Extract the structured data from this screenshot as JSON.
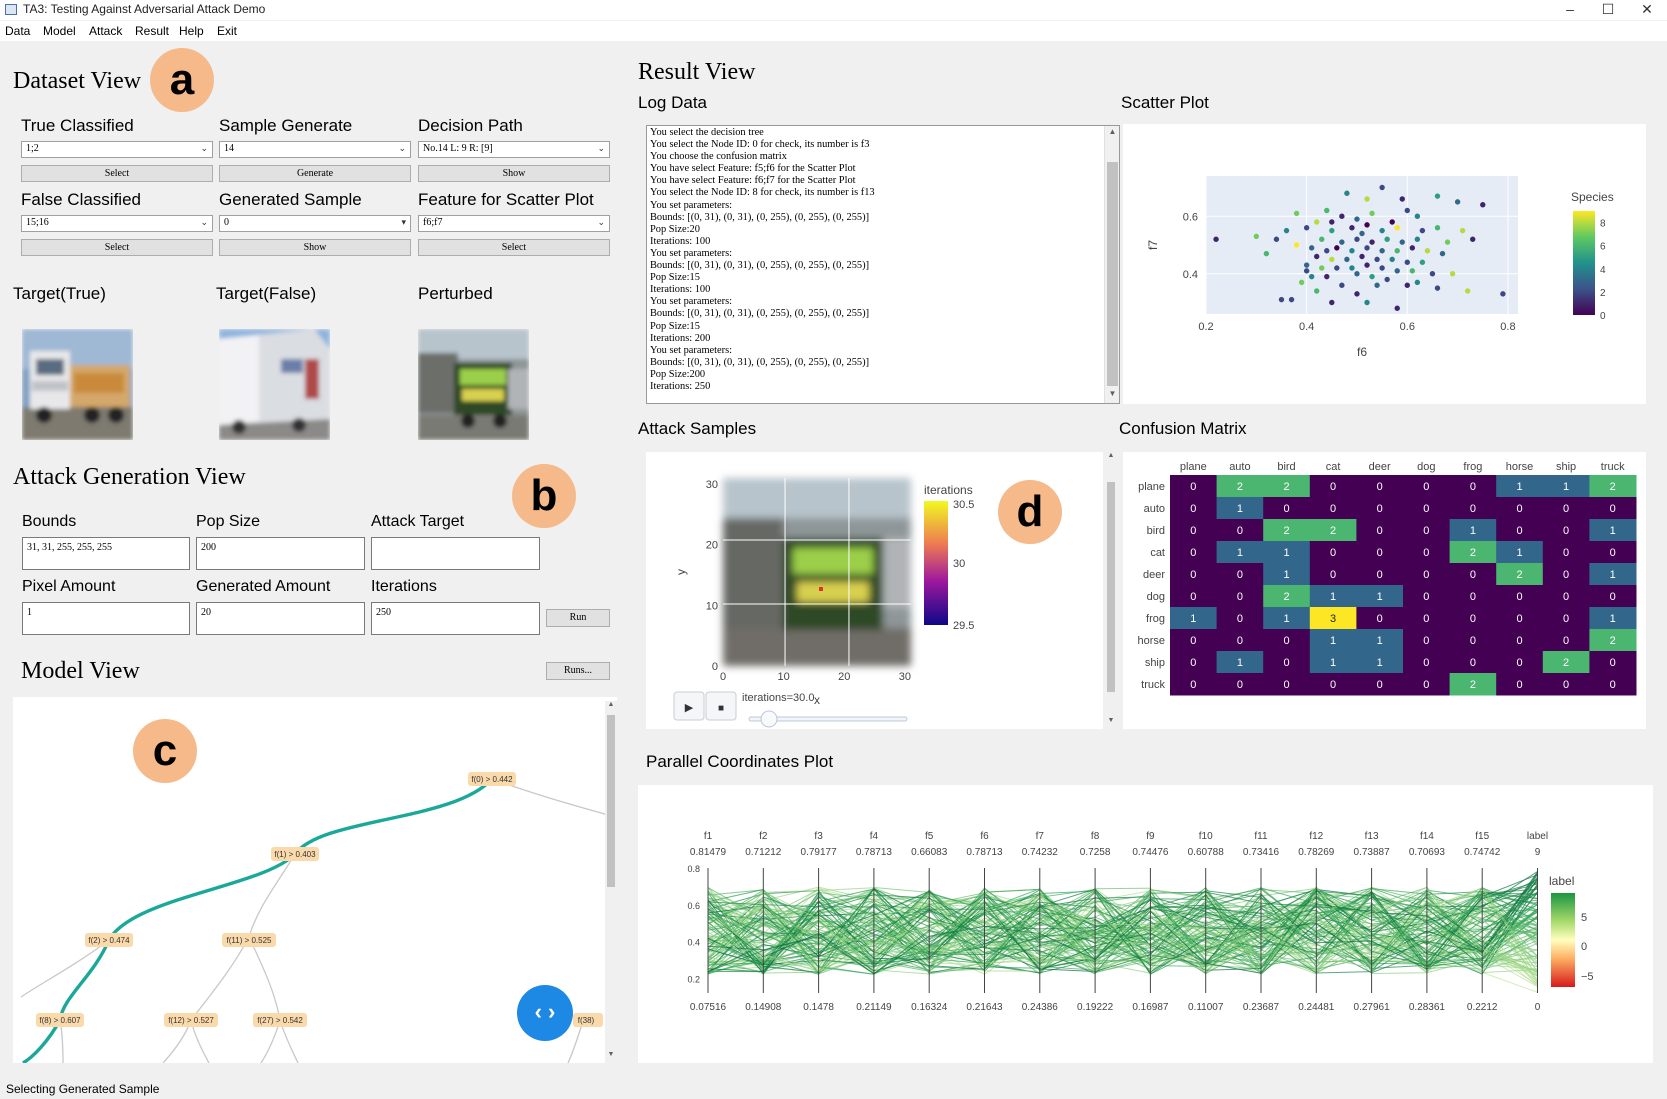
{
  "window": {
    "title": "TA3: Testing Against Adversarial Attack Demo",
    "minimize": "–",
    "maximize": "☐",
    "close": "✕"
  },
  "menu": [
    "Data",
    "Model",
    "Attack",
    "Result",
    "Help",
    "Exit"
  ],
  "badges": {
    "a": "a",
    "b": "b",
    "c": "c",
    "d": "d"
  },
  "dataset_view": {
    "title": "Dataset View",
    "true_classified": {
      "label": "True Classified",
      "value": "1;2",
      "button": "Select"
    },
    "sample_generate": {
      "label": "Sample Generate",
      "value": "14",
      "button": "Generate"
    },
    "decision_path": {
      "label": "Decision Path",
      "value": "No.14 L: 9 R: [9]",
      "button": "Show"
    },
    "false_classified": {
      "label": "False Classified",
      "value": "15;16",
      "button": "Select"
    },
    "generated_sample": {
      "label": "Generated Sample",
      "value": "0",
      "button": "Show"
    },
    "feature_scatter": {
      "label": "Feature for Scatter Plot",
      "value": "f6;f7",
      "button": "Select"
    },
    "images": {
      "target_true": "Target(True)",
      "target_false": "Target(False)",
      "perturbed": "Perturbed"
    }
  },
  "attack_view": {
    "title": "Attack Generation View",
    "bounds": {
      "label": "Bounds",
      "value": "31, 31, 255, 255, 255"
    },
    "pop_size": {
      "label": "Pop Size",
      "value": "200"
    },
    "attack_target": {
      "label": "Attack Target",
      "value": ""
    },
    "pixel_amount": {
      "label": "Pixel Amount",
      "value": "1"
    },
    "generated_amount": {
      "label": "Generated Amount",
      "value": "20"
    },
    "iterations": {
      "label": "Iterations",
      "value": "250"
    },
    "run_button": "Run"
  },
  "model_view": {
    "title": "Model View",
    "runs_button": "Runs...",
    "nodes": [
      "f(0) > 0.442",
      "f(1) > 0.403",
      "f(2) > 0.474",
      "f(11) > 0.525",
      "f(8) > 0.607",
      "f(12) > 0.527",
      "f(27) > 0.542",
      "f(38)"
    ],
    "toggle_icon": "‹ ›"
  },
  "result_view": {
    "title": "Result View",
    "log_title": "Log Data",
    "log_lines": [
      "You select the decision tree",
      "You select the Node ID: 0 for check, its number is f3",
      "You choose the confusion matrix",
      "You have select Feature: f5;f6 for the Scatter Plot",
      "You have select Feature: f6;f7 for the Scatter Plot",
      "You select the Node ID: 8 for check, its number is f13",
      "You set parameters:",
      "Bounds: [(0, 31), (0, 31), (0, 255), (0, 255), (0, 255)]",
      "Pop Size:20",
      "Iterations: 100",
      "You set parameters:",
      "Bounds: [(0, 31), (0, 31), (0, 255), (0, 255), (0, 255)]",
      "Pop Size:15",
      "Iterations: 100",
      "You set parameters:",
      "Bounds: [(0, 31), (0, 31), (0, 255), (0, 255), (0, 255)]",
      "Pop Size:15",
      "Iterations: 200",
      "You set parameters:",
      "Bounds: [(0, 31), (0, 31), (0, 255), (0, 255), (0, 255)]",
      "Pop Size:200",
      "Iterations: 250"
    ],
    "scatter_title": "Scatter Plot",
    "attack_title": "Attack Samples",
    "confusion_title": "Confusion Matrix",
    "parallel_title": "Parallel Coordinates Plot"
  },
  "status": "Selecting Generated Sample",
  "chart_data": [
    {
      "type": "scatter",
      "xlabel": "f6",
      "ylabel": "f7",
      "xticks": [
        "0.2",
        "0.4",
        "0.6",
        "0.8"
      ],
      "yticks": [
        "0.4",
        "0.6"
      ],
      "xlim": [
        0.2,
        0.82
      ],
      "ylim": [
        0.26,
        0.74
      ],
      "colorbar": {
        "title": "Species",
        "ticks": [
          "0",
          "2",
          "4",
          "6",
          "8"
        ],
        "range": [
          0,
          9
        ]
      },
      "points": [
        [
          0.55,
          0.7,
          2
        ],
        [
          0.48,
          0.68,
          4
        ],
        [
          0.52,
          0.66,
          8
        ],
        [
          0.59,
          0.66,
          1
        ],
        [
          0.7,
          0.65,
          3
        ],
        [
          0.66,
          0.67,
          5
        ],
        [
          0.75,
          0.64,
          1
        ],
        [
          0.44,
          0.62,
          6
        ],
        [
          0.38,
          0.61,
          7
        ],
        [
          0.6,
          0.62,
          2
        ],
        [
          0.62,
          0.6,
          4
        ],
        [
          0.47,
          0.6,
          1
        ],
        [
          0.5,
          0.59,
          3
        ],
        [
          0.53,
          0.61,
          7
        ],
        [
          0.57,
          0.58,
          0
        ],
        [
          0.42,
          0.58,
          8
        ],
        [
          0.4,
          0.56,
          2
        ],
        [
          0.45,
          0.55,
          5
        ],
        [
          0.49,
          0.56,
          1
        ],
        [
          0.51,
          0.54,
          3
        ],
        [
          0.55,
          0.55,
          4
        ],
        [
          0.58,
          0.56,
          9
        ],
        [
          0.63,
          0.55,
          2
        ],
        [
          0.66,
          0.56,
          6
        ],
        [
          0.71,
          0.55,
          8
        ],
        [
          0.36,
          0.55,
          4
        ],
        [
          0.3,
          0.53,
          7
        ],
        [
          0.22,
          0.52,
          1
        ],
        [
          0.34,
          0.52,
          2
        ],
        [
          0.43,
          0.52,
          6
        ],
        [
          0.47,
          0.51,
          3
        ],
        [
          0.5,
          0.52,
          2
        ],
        [
          0.53,
          0.51,
          1
        ],
        [
          0.56,
          0.52,
          5
        ],
        [
          0.59,
          0.51,
          3
        ],
        [
          0.62,
          0.52,
          4
        ],
        [
          0.68,
          0.51,
          7
        ],
        [
          0.73,
          0.52,
          1
        ],
        [
          0.38,
          0.5,
          9
        ],
        [
          0.41,
          0.49,
          3
        ],
        [
          0.44,
          0.48,
          2
        ],
        [
          0.46,
          0.49,
          0
        ],
        [
          0.49,
          0.48,
          4
        ],
        [
          0.52,
          0.49,
          2
        ],
        [
          0.55,
          0.48,
          3
        ],
        [
          0.58,
          0.48,
          6
        ],
        [
          0.61,
          0.49,
          1
        ],
        [
          0.64,
          0.48,
          8
        ],
        [
          0.67,
          0.47,
          3
        ],
        [
          0.32,
          0.47,
          6
        ],
        [
          0.42,
          0.46,
          1
        ],
        [
          0.45,
          0.45,
          8
        ],
        [
          0.48,
          0.45,
          3
        ],
        [
          0.51,
          0.46,
          1
        ],
        [
          0.54,
          0.45,
          2
        ],
        [
          0.57,
          0.45,
          4
        ],
        [
          0.6,
          0.44,
          2
        ],
        [
          0.63,
          0.44,
          5
        ],
        [
          0.4,
          0.43,
          3
        ],
        [
          0.43,
          0.42,
          7
        ],
        [
          0.46,
          0.42,
          2
        ],
        [
          0.49,
          0.42,
          4
        ],
        [
          0.52,
          0.43,
          1
        ],
        [
          0.55,
          0.42,
          2
        ],
        [
          0.58,
          0.41,
          3
        ],
        [
          0.61,
          0.41,
          6
        ],
        [
          0.65,
          0.4,
          2
        ],
        [
          0.69,
          0.4,
          8
        ],
        [
          0.41,
          0.39,
          4
        ],
        [
          0.44,
          0.39,
          1
        ],
        [
          0.5,
          0.4,
          3
        ],
        [
          0.53,
          0.39,
          5
        ],
        [
          0.56,
          0.38,
          2
        ],
        [
          0.62,
          0.37,
          4
        ],
        [
          0.39,
          0.37,
          7
        ],
        [
          0.47,
          0.36,
          2
        ],
        [
          0.54,
          0.36,
          3
        ],
        [
          0.6,
          0.36,
          1
        ],
        [
          0.66,
          0.35,
          2
        ],
        [
          0.72,
          0.34,
          8
        ],
        [
          0.79,
          0.33,
          2
        ],
        [
          0.42,
          0.34,
          6
        ],
        [
          0.5,
          0.33,
          1
        ],
        [
          0.35,
          0.31,
          2
        ],
        [
          0.37,
          0.31,
          2
        ],
        [
          0.45,
          0.3,
          1
        ],
        [
          0.52,
          0.3,
          4
        ],
        [
          0.58,
          0.28,
          1
        ],
        [
          0.4,
          0.41,
          2
        ],
        [
          0.52,
          0.57,
          0
        ],
        [
          0.45,
          0.58,
          1
        ]
      ]
    },
    {
      "type": "heatmap",
      "title": "Attack Samples",
      "xlabel": "x",
      "ylabel": "y",
      "xticks": [
        "0",
        "10",
        "20",
        "30"
      ],
      "yticks": [
        "0",
        "10",
        "20",
        "30"
      ],
      "colorbar": {
        "title": "iterations",
        "ticks": [
          "30.5",
          "30",
          "29.5"
        ]
      },
      "slider_label": "iterations=30.0",
      "slider_value": 30.0,
      "play_icon": "▶",
      "stop_icon": "■"
    },
    {
      "type": "heatmap",
      "title": "Confusion Matrix",
      "categories": [
        "plane",
        "auto",
        "bird",
        "cat",
        "deer",
        "dog",
        "frog",
        "horse",
        "ship",
        "truck"
      ],
      "matrix": [
        [
          0,
          2,
          2,
          0,
          0,
          0,
          0,
          1,
          1,
          2
        ],
        [
          0,
          1,
          0,
          0,
          0,
          0,
          0,
          0,
          0,
          0
        ],
        [
          0,
          0,
          2,
          2,
          0,
          0,
          1,
          0,
          0,
          1
        ],
        [
          0,
          1,
          1,
          0,
          0,
          0,
          2,
          1,
          0,
          0
        ],
        [
          0,
          0,
          1,
          0,
          0,
          0,
          0,
          2,
          0,
          1
        ],
        [
          0,
          0,
          2,
          1,
          1,
          0,
          0,
          0,
          0,
          0
        ],
        [
          1,
          0,
          1,
          3,
          0,
          0,
          0,
          0,
          0,
          1
        ],
        [
          0,
          0,
          0,
          1,
          1,
          0,
          0,
          0,
          0,
          2
        ],
        [
          0,
          1,
          0,
          1,
          1,
          0,
          0,
          0,
          2,
          0
        ],
        [
          0,
          0,
          0,
          0,
          0,
          0,
          2,
          0,
          0,
          0
        ]
      ]
    },
    {
      "type": "line",
      "title": "Parallel Coordinates Plot",
      "dimensions": [
        "f1",
        "f2",
        "f3",
        "f4",
        "f5",
        "f6",
        "f7",
        "f8",
        "f9",
        "f10",
        "f11",
        "f12",
        "f13",
        "f14",
        "f15",
        "label"
      ],
      "max_values": [
        "0.81479",
        "0.71212",
        "0.79177",
        "0.78713",
        "0.66083",
        "0.78713",
        "0.74232",
        "0.7258",
        "0.74476",
        "0.60788",
        "0.73416",
        "0.78269",
        "0.73887",
        "0.70693",
        "0.74742",
        "9"
      ],
      "min_values": [
        "0.07516",
        "0.14908",
        "0.1478",
        "0.21149",
        "0.16324",
        "0.21643",
        "0.24386",
        "0.19222",
        "0.16987",
        "0.11007",
        "0.23687",
        "0.24481",
        "0.27961",
        "0.28361",
        "0.2212",
        "0"
      ],
      "axis_ticks": [
        "0.8",
        "0.6",
        "0.4",
        "0.2"
      ],
      "colorbar": {
        "title": "label",
        "ticks": [
          "5",
          "0",
          "−5"
        ]
      }
    }
  ]
}
